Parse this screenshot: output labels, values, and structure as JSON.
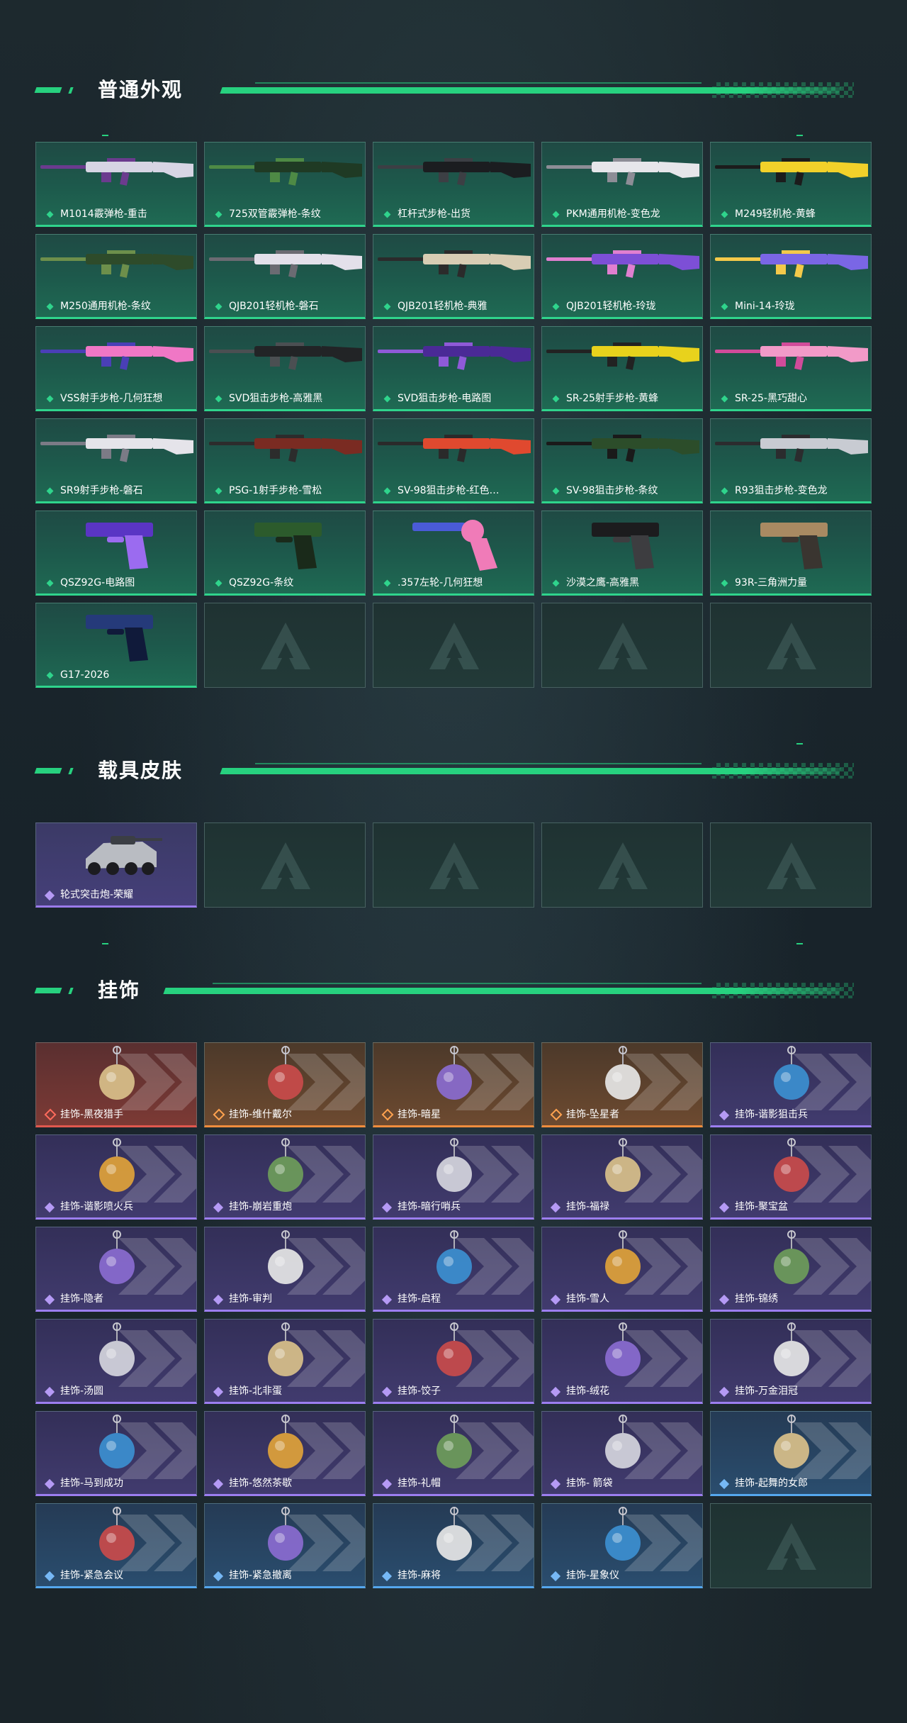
{
  "sections": {
    "appearance": {
      "title": "普通外观",
      "items": [
        {
          "label": "M1014霰弹枪-重击",
          "art": "shotgun-pink-icon"
        },
        {
          "label": "725双管霰弹枪-条纹",
          "art": "shotgun-green-icon"
        },
        {
          "label": "杠杆式步枪-出货",
          "art": "lever-rifle-icon"
        },
        {
          "label": "PKM通用机枪-变色龙",
          "art": "machinegun-white-icon"
        },
        {
          "label": "M249轻机枪-黄蜂",
          "art": "machinegun-yellow-icon"
        },
        {
          "label": "M250通用机枪-条纹",
          "art": "machinegun-green-icon"
        },
        {
          "label": "QJB201轻机枪-磐石",
          "art": "machinegun-marble-icon"
        },
        {
          "label": "QJB201轻机枪-典雅",
          "art": "machinegun-cream-icon"
        },
        {
          "label": "QJB201轻机枪-玲珑",
          "art": "machinegun-purple-icon"
        },
        {
          "label": "Mini-14-玲珑",
          "art": "rifle-rainbow-icon"
        },
        {
          "label": "VSS射手步枪-几何狂想",
          "art": "rifle-pink-geo-icon"
        },
        {
          "label": "SVD狙击步枪-高雅黑",
          "art": "sniper-black-icon"
        },
        {
          "label": "SVD狙击步枪-电路图",
          "art": "sniper-purple-icon"
        },
        {
          "label": "SR-25射手步枪-黄蜂",
          "art": "rifle-yellow-icon"
        },
        {
          "label": "SR-25-黑巧甜心",
          "art": "rifle-pink-icon"
        },
        {
          "label": "SR9射手步枪-磐石",
          "art": "rifle-white-icon"
        },
        {
          "label": "PSG-1射手步枪-雪松",
          "art": "sniper-red-icon"
        },
        {
          "label": "SV-98狙击步枪-红色…",
          "art": "sniper-orange-icon"
        },
        {
          "label": "SV-98狙击步枪-条纹",
          "art": "sniper-green-icon"
        },
        {
          "label": "R93狙击步枪-变色龙",
          "art": "sniper-silver-icon"
        },
        {
          "label": "QSZ92G-电路图",
          "art": "pistol-purple-icon"
        },
        {
          "label": "QSZ92G-条纹",
          "art": "pistol-green-icon"
        },
        {
          "label": ".357左轮-几何狂想",
          "art": "revolver-pink-icon"
        },
        {
          "label": "沙漠之鹰-高雅黑",
          "art": "pistol-black-icon"
        },
        {
          "label": "93R-三角洲力量",
          "art": "pistol-tan-icon"
        },
        {
          "label": "G17-2026",
          "art": "pistol-navy-icon"
        }
      ],
      "empty_slots": 4
    },
    "vehicle": {
      "title": "载具皮肤",
      "items": [
        {
          "label": "轮式突击炮-荣耀",
          "art": "armored-vehicle-icon"
        }
      ],
      "empty_slots": 4
    },
    "charms": {
      "title": "挂饰",
      "items": [
        {
          "label": "挂饰-黑夜猎手",
          "rarity": "red",
          "art": "charm-cat-icon"
        },
        {
          "label": "挂饰-维什戴尔",
          "rarity": "orange",
          "art": "charm-card-icon"
        },
        {
          "label": "挂饰-暗星",
          "rarity": "orange",
          "art": "charm-bird-icon"
        },
        {
          "label": "挂饰-坠星者",
          "rarity": "orange",
          "art": "charm-crystal-icon"
        },
        {
          "label": "挂饰-谐影狙击兵",
          "rarity": "purple",
          "art": "charm-sniper-icon"
        },
        {
          "label": "挂饰-谐影喷火兵",
          "rarity": "purple",
          "art": "charm-soldier-icon"
        },
        {
          "label": "挂饰-崩岩重炮",
          "rarity": "purple",
          "art": "charm-heavy-icon"
        },
        {
          "label": "挂饰-暗行哨兵",
          "rarity": "purple",
          "art": "charm-sentinel-icon"
        },
        {
          "label": "挂饰-福禄",
          "rarity": "purple",
          "art": "charm-gourd-icon"
        },
        {
          "label": "挂饰-聚宝盆",
          "rarity": "purple",
          "art": "charm-treasure-icon"
        },
        {
          "label": "挂饰-隐者",
          "rarity": "purple",
          "art": "charm-tarot-icon"
        },
        {
          "label": "挂饰-审判",
          "rarity": "purple",
          "art": "charm-judgement-icon"
        },
        {
          "label": "挂饰-启程",
          "rarity": "purple",
          "art": "charm-compass-icon"
        },
        {
          "label": "挂饰-雪人",
          "rarity": "purple",
          "art": "charm-snowman-icon"
        },
        {
          "label": "挂饰-锦绣",
          "rarity": "purple",
          "art": "charm-butterfly-icon"
        },
        {
          "label": "挂饰-汤圆",
          "rarity": "purple",
          "art": "charm-dumpling-icon"
        },
        {
          "label": "挂饰-北非蛋",
          "rarity": "purple",
          "art": "charm-egg-icon"
        },
        {
          "label": "挂饰-饺子",
          "rarity": "purple",
          "art": "charm-jiaozi-icon"
        },
        {
          "label": "挂饰-绒花",
          "rarity": "purple",
          "art": "charm-flower-icon"
        },
        {
          "label": "挂饰-万金泪冠",
          "rarity": "purple",
          "art": "charm-crown-icon"
        },
        {
          "label": "挂饰-马到成功",
          "rarity": "purple",
          "art": "charm-horse-icon"
        },
        {
          "label": "挂饰-悠然茶歇",
          "rarity": "purple",
          "art": "charm-cupcake-icon"
        },
        {
          "label": "挂饰-礼帽",
          "rarity": "purple",
          "art": "charm-hat-icon"
        },
        {
          "label": "挂饰- 箭袋",
          "rarity": "purple",
          "art": "charm-quiver-icon"
        },
        {
          "label": "挂饰-起舞的女郎",
          "rarity": "blue",
          "art": "charm-dancer-icon"
        },
        {
          "label": "挂饰-紧急会议",
          "rarity": "blue",
          "art": "charm-meeting-icon"
        },
        {
          "label": "挂饰-紧急撤离",
          "rarity": "blue",
          "art": "charm-exit-icon"
        },
        {
          "label": "挂饰-麻将",
          "rarity": "blue",
          "art": "charm-mahjong-icon"
        },
        {
          "label": "挂饰-星象仪",
          "rarity": "blue",
          "art": "charm-astrolabe-icon"
        }
      ],
      "empty_slots": 1
    }
  },
  "colors": {
    "accent": "#27d17f",
    "weapon_rarity": "#2fd48c",
    "red_rarity": "#e0584e",
    "orange_rarity": "#f08d3d",
    "purple_rarity": "#9c7ef0",
    "blue_rarity": "#55a7ee"
  }
}
